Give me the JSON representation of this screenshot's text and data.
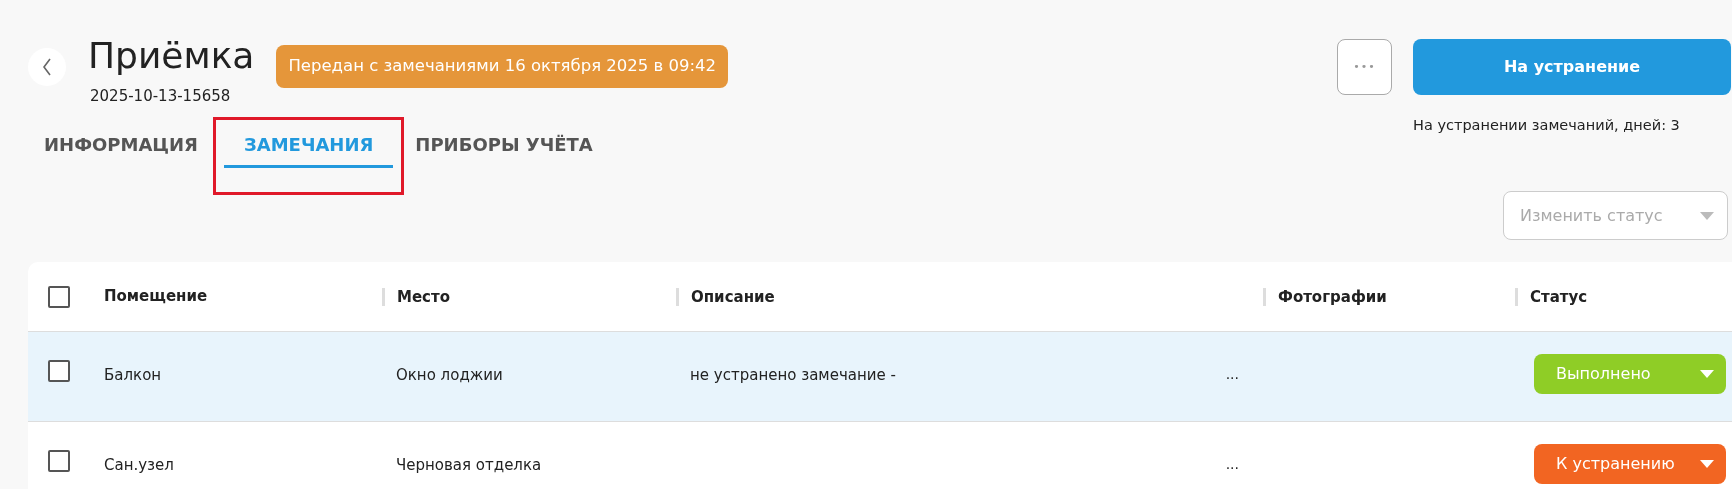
{
  "header": {
    "title": "Приёмка",
    "code": "2025-10-13-15658",
    "badge": "Передан с замечаниями 16 октября 2025 в 09:42"
  },
  "actions": {
    "more_label": "•••",
    "primary": "На устранение",
    "note": "На устранении замечаний, дней: 3"
  },
  "tabs": [
    {
      "label": "ИНФОРМАЦИЯ",
      "selected": false
    },
    {
      "label": "ЗАМЕЧАНИЯ",
      "selected": true
    },
    {
      "label": "ПРИБОРЫ УЧЁТА",
      "selected": false
    }
  ],
  "status_select": {
    "placeholder": "Изменить статус",
    "disabled": true
  },
  "table": {
    "select_all_checked": false,
    "columns": [
      "Помещение",
      "Место",
      "Описание",
      "Фотографии",
      "Статус"
    ],
    "rows": [
      {
        "selected": true,
        "checked": false,
        "room": "Балкон",
        "place": "Окно лоджии",
        "description": "не устранено замечание -",
        "more": "...",
        "status": "Выполнено",
        "color": "#8fcd26"
      },
      {
        "selected": false,
        "checked": false,
        "room": "Сан.узел",
        "place": "Черновая отделка",
        "description": "",
        "more": "...",
        "status": "К устранению",
        "color": "#f26522"
      }
    ]
  }
}
